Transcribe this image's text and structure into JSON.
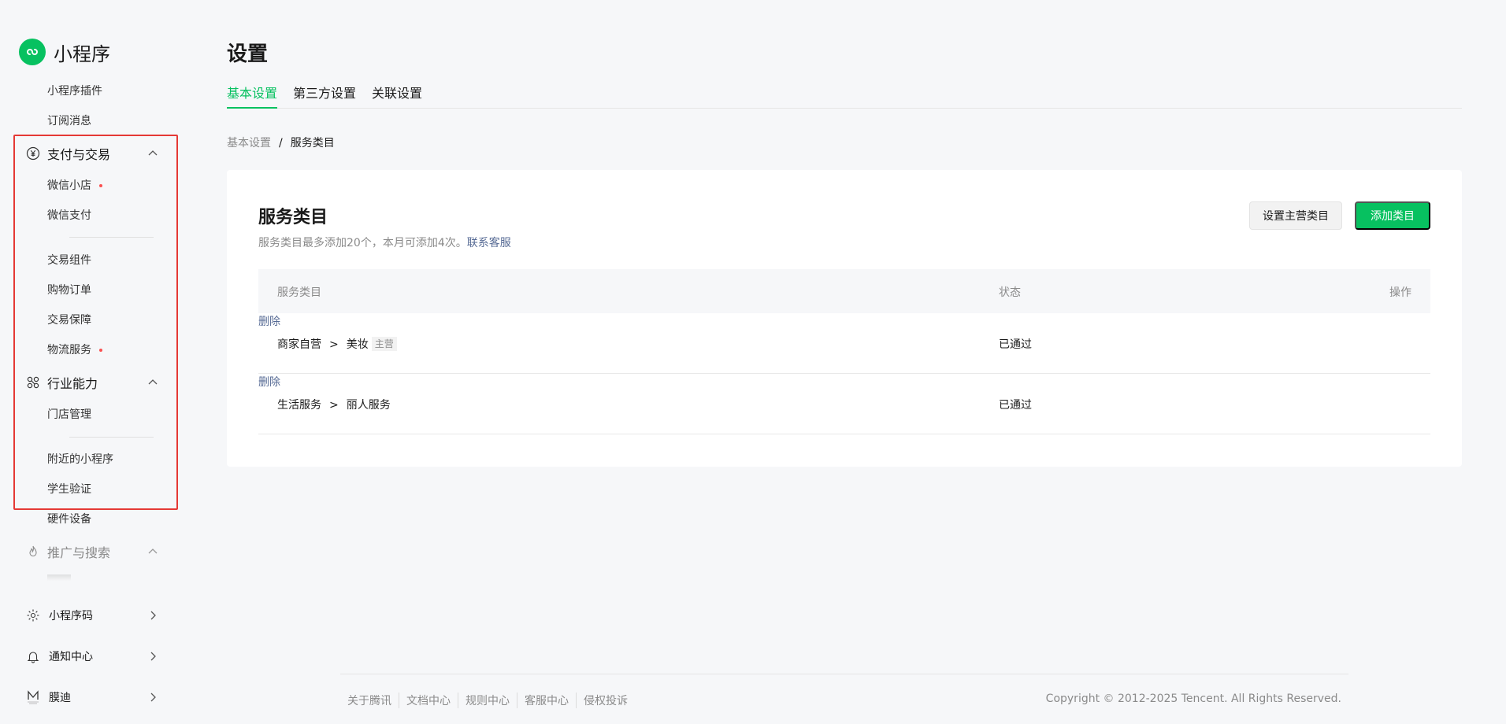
{
  "app": {
    "name": "小程序",
    "accent_color": "#07c160",
    "logo_icon": "miniprogram-logo-icon"
  },
  "sidebar": {
    "top_items": [
      {
        "label": "小程序插件"
      },
      {
        "label": "订阅消息"
      }
    ],
    "payment_group": {
      "label": "支付与交易",
      "icon": "yen-circle-icon",
      "expanded": true,
      "items": [
        {
          "label": "微信小店",
          "dot": true
        },
        {
          "label": "微信支付"
        },
        {
          "label": "交易组件"
        },
        {
          "label": "购物订单"
        },
        {
          "label": "交易保障"
        },
        {
          "label": "物流服务",
          "dot": true
        }
      ]
    },
    "industry_group": {
      "label": "行业能力",
      "icon": "industry-nodes-icon",
      "expanded": true,
      "items": [
        {
          "label": "门店管理"
        },
        {
          "label": "附近的小程序"
        },
        {
          "label": "学生验证"
        },
        {
          "label": "硬件设备"
        }
      ]
    },
    "promo_group": {
      "label": "推广与搜索",
      "icon": "fire-icon",
      "expanded": true
    },
    "bottom_items": [
      {
        "label": "小程序码",
        "icon": "qrcode-sun-icon"
      },
      {
        "label": "通知中心",
        "icon": "bell-icon"
      },
      {
        "label": "膜迪",
        "icon": "account-avatar-icon"
      }
    ],
    "highlight_color": "#e53935"
  },
  "page": {
    "title": "设置",
    "tabs": [
      {
        "label": "基本设置",
        "active": true
      },
      {
        "label": "第三方设置",
        "active": false
      },
      {
        "label": "关联设置",
        "active": false
      }
    ],
    "breadcrumb": {
      "parent": "基本设置",
      "separator": "/",
      "current": "服务类目"
    }
  },
  "card": {
    "title": "服务类目",
    "description": "服务类目最多添加20个，本月可添加4次。",
    "contact_link": "联系客服",
    "buttons": {
      "set_primary": "设置主营类目",
      "add": "添加类目"
    },
    "table": {
      "headers": {
        "category": "服务类目",
        "status": "状态",
        "action": "操作"
      },
      "rows": [
        {
          "parent": "商家自营",
          "separator": ">",
          "child": "美妆",
          "tag": "主营",
          "status": "已通过",
          "action": "删除"
        },
        {
          "parent": "生活服务",
          "separator": ">",
          "child": "丽人服务",
          "tag": "",
          "status": "已通过",
          "action": "删除"
        }
      ]
    }
  },
  "footer": {
    "links": [
      "关于腾讯",
      "文档中心",
      "规则中心",
      "客服中心",
      "侵权投诉"
    ],
    "copyright": "Copyright © 2012-2025 Tencent. All Rights Reserved."
  }
}
